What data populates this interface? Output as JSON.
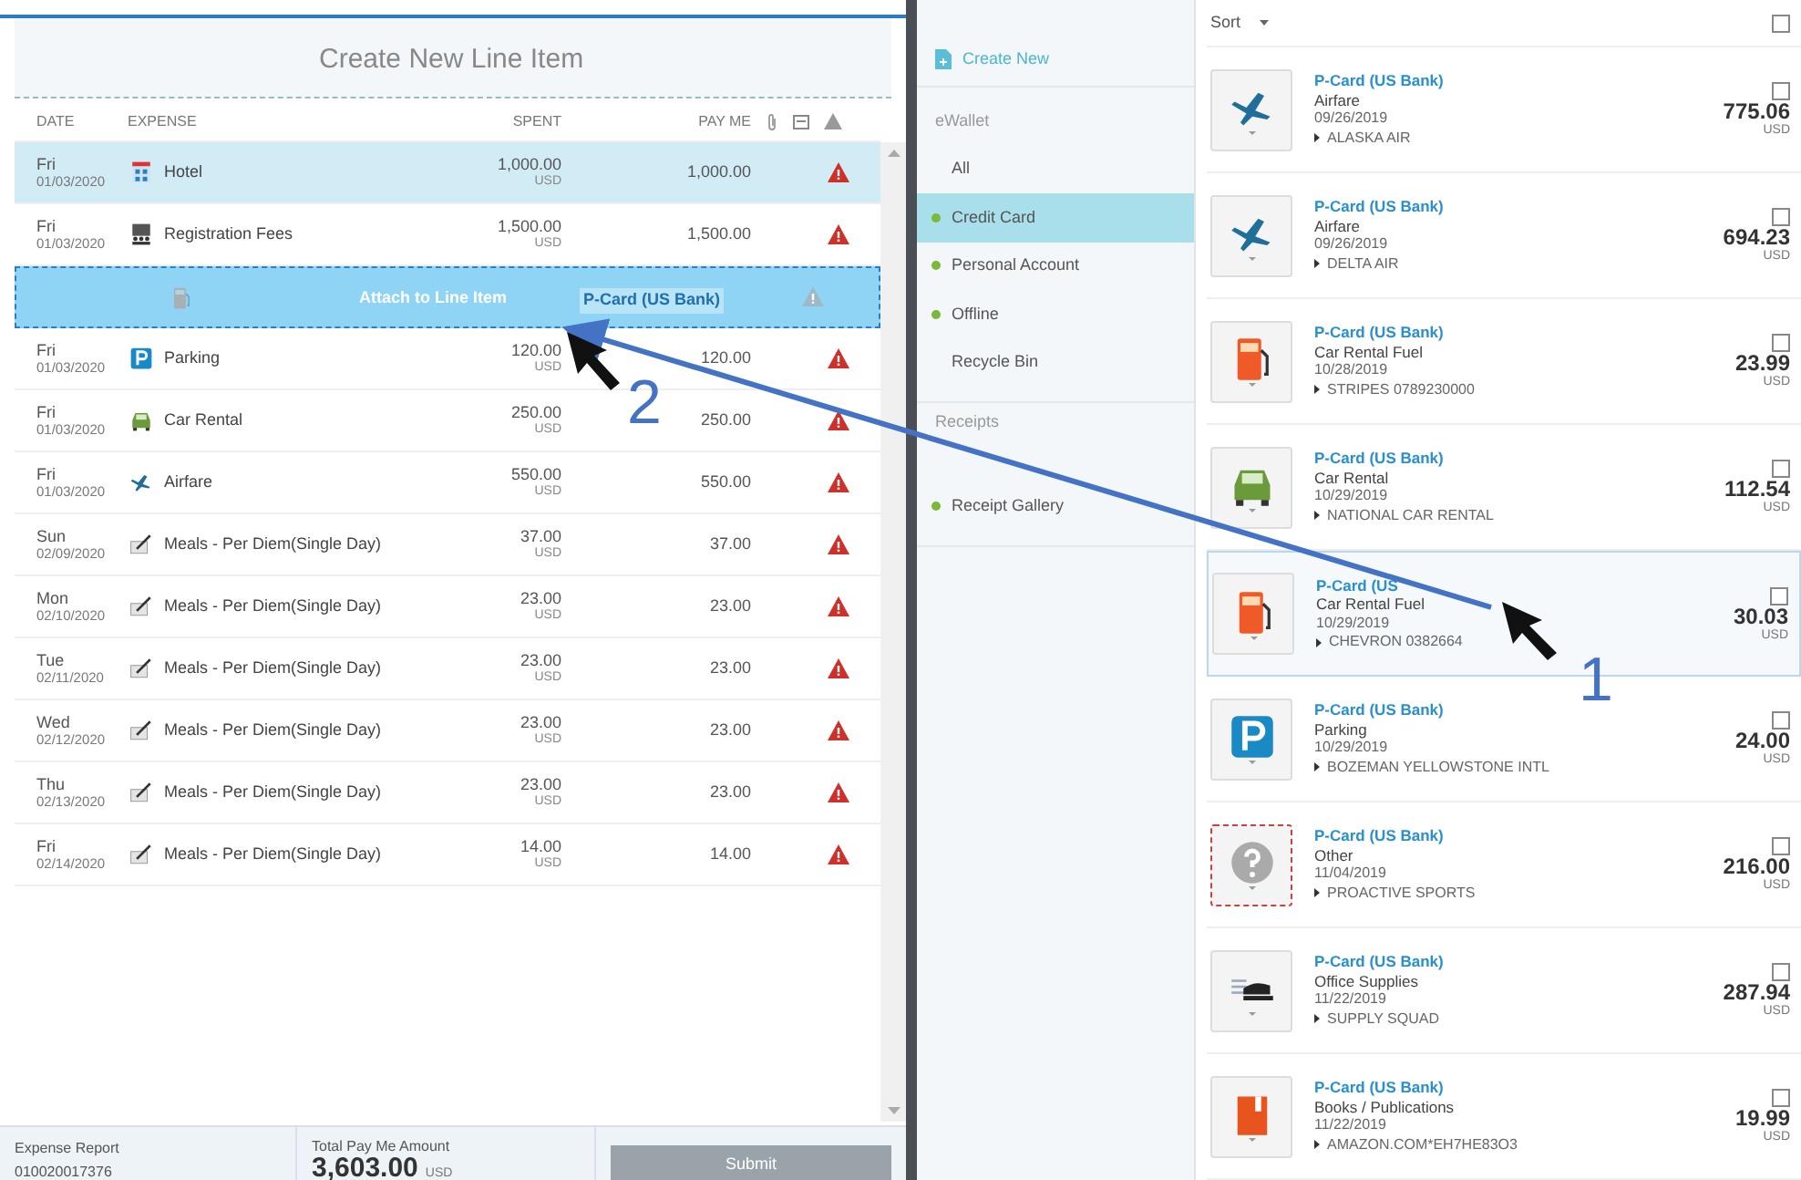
{
  "report": {
    "panel_title": "Create New Line Item",
    "columns": [
      "DATE",
      "EXPENSE",
      "SPENT",
      "PAY ME"
    ],
    "rows": [
      {
        "kind": "hotel",
        "drop_target": false,
        "selected": true,
        "day": "Fri",
        "date": "01/03/2020",
        "expense": "Hotel",
        "spent": "1,000.00",
        "currency": "USD",
        "pay_me": "1,000.00",
        "warning": true
      },
      {
        "kind": "registration",
        "drop_target": false,
        "selected": false,
        "day": "Fri",
        "date": "01/03/2020",
        "expense": "Registration Fees",
        "spent": "1,500.00",
        "currency": "USD",
        "pay_me": "1,500.00",
        "warning": true
      },
      {
        "kind": "fuel",
        "drop_target": true,
        "selected": false,
        "attach_label": "Attach to Line Item",
        "warning": true
      },
      {
        "kind": "parking",
        "drop_target": false,
        "selected": false,
        "day": "Fri",
        "date": "01/03/2020",
        "expense": "Parking",
        "spent": "120.00",
        "currency": "USD",
        "pay_me": "120.00",
        "warning": true
      },
      {
        "kind": "car",
        "drop_target": false,
        "selected": false,
        "day": "Fri",
        "date": "01/03/2020",
        "expense": "Car Rental",
        "spent": "250.00",
        "currency": "USD",
        "pay_me": "250.00",
        "warning": true
      },
      {
        "kind": "airfare",
        "drop_target": false,
        "selected": false,
        "day": "Fri",
        "date": "01/03/2020",
        "expense": "Airfare",
        "spent": "550.00",
        "currency": "USD",
        "pay_me": "550.00",
        "warning": true
      },
      {
        "kind": "meals",
        "drop_target": false,
        "selected": false,
        "day": "Sun",
        "date": "02/09/2020",
        "expense": "Meals - Per Diem(Single Day)",
        "spent": "37.00",
        "currency": "USD",
        "pay_me": "37.00",
        "warning": true
      },
      {
        "kind": "meals",
        "drop_target": false,
        "selected": false,
        "day": "Mon",
        "date": "02/10/2020",
        "expense": "Meals - Per Diem(Single Day)",
        "spent": "23.00",
        "currency": "USD",
        "pay_me": "23.00",
        "warning": true
      },
      {
        "kind": "meals",
        "drop_target": false,
        "selected": false,
        "day": "Tue",
        "date": "02/11/2020",
        "expense": "Meals - Per Diem(Single Day)",
        "spent": "23.00",
        "currency": "USD",
        "pay_me": "23.00",
        "warning": true
      },
      {
        "kind": "meals",
        "drop_target": false,
        "selected": false,
        "day": "Wed",
        "date": "02/12/2020",
        "expense": "Meals - Per Diem(Single Day)",
        "spent": "23.00",
        "currency": "USD",
        "pay_me": "23.00",
        "warning": true
      },
      {
        "kind": "meals",
        "drop_target": false,
        "selected": false,
        "day": "Thu",
        "date": "02/13/2020",
        "expense": "Meals - Per Diem(Single Day)",
        "spent": "23.00",
        "currency": "USD",
        "pay_me": "23.00",
        "warning": true
      },
      {
        "kind": "meals",
        "drop_target": false,
        "selected": false,
        "day": "Fri",
        "date": "02/14/2020",
        "expense": "Meals - Per Diem(Single Day)",
        "spent": "14.00",
        "currency": "USD",
        "pay_me": "14.00",
        "warning": true
      }
    ],
    "drag_ghost": {
      "source": "P-Card (US Bank)"
    },
    "footer": {
      "report_label": "Expense Report",
      "report_number": "010020017376",
      "total_label": "Total Pay Me Amount",
      "total": "3,603.00",
      "total_currency": "USD",
      "submit": {
        "label": "Submit",
        "disabled": true
      }
    }
  },
  "sidebar": {
    "create_new": "Create New",
    "sections": [
      {
        "title": "eWallet",
        "items": [
          {
            "label": "All",
            "selected": false,
            "dot": false
          },
          {
            "label": "Credit Card",
            "selected": true,
            "dot": true
          },
          {
            "label": "Personal Account",
            "selected": false,
            "dot": true
          },
          {
            "label": "Offline",
            "selected": false,
            "dot": true
          },
          {
            "label": "Recycle Bin",
            "selected": false,
            "dot": false
          }
        ]
      },
      {
        "title": "Receipts",
        "items": [
          {
            "label": "Receipt Gallery",
            "selected": false,
            "dot": true
          }
        ]
      }
    ]
  },
  "wallet": {
    "sort": "Sort",
    "select_all_checked": false,
    "items": [
      {
        "kind": "airfare",
        "source": "P-Card (US Bank)",
        "category": "Airfare",
        "date": "09/26/2019",
        "merchant": "ALASKA AIR",
        "amount": "775.06",
        "currency": "USD",
        "checked": false,
        "selected": false
      },
      {
        "kind": "airfare",
        "source": "P-Card (US Bank)",
        "category": "Airfare",
        "date": "09/26/2019",
        "merchant": "DELTA AIR",
        "amount": "694.23",
        "currency": "USD",
        "checked": false,
        "selected": false
      },
      {
        "kind": "fuel",
        "source": "P-Card (US Bank)",
        "category": "Car Rental Fuel",
        "date": "10/28/2019",
        "merchant": "STRIPES 0789230000",
        "amount": "23.99",
        "currency": "USD",
        "checked": false,
        "selected": false
      },
      {
        "kind": "car",
        "source": "P-Card (US Bank)",
        "category": "Car Rental",
        "date": "10/29/2019",
        "merchant": "NATIONAL CAR RENTAL",
        "amount": "112.54",
        "currency": "USD",
        "checked": false,
        "selected": false
      },
      {
        "kind": "fuel",
        "source": "P-Card (US",
        "category": "Car Rental Fuel",
        "date": "10/29/2019",
        "merchant": "CHEVRON 0382664",
        "amount": "30.03",
        "currency": "USD",
        "checked": false,
        "selected": true
      },
      {
        "kind": "parking",
        "source": "P-Card (US Bank)",
        "category": "Parking",
        "date": "10/29/2019",
        "merchant": "BOZEMAN YELLOWSTONE INTL",
        "amount": "24.00",
        "currency": "USD",
        "checked": false,
        "selected": false
      },
      {
        "kind": "other",
        "source": "P-Card (US Bank)",
        "category": "Other",
        "date": "11/04/2019",
        "merchant": "PROACTIVE SPORTS",
        "amount": "216.00",
        "currency": "USD",
        "checked": false,
        "selected": false
      },
      {
        "kind": "office",
        "source": "P-Card (US Bank)",
        "category": "Office Supplies",
        "date": "11/22/2019",
        "merchant": "SUPPLY SQUAD",
        "amount": "287.94",
        "currency": "USD",
        "checked": false,
        "selected": false
      },
      {
        "kind": "books",
        "source": "P-Card (US Bank)",
        "category": "Books / Publications",
        "date": "11/22/2019",
        "merchant": "AMAZON.COM*EH7HE83O3",
        "amount": "19.99",
        "currency": "USD",
        "checked": false,
        "selected": false
      }
    ]
  },
  "annotations": [
    "1",
    "2"
  ]
}
